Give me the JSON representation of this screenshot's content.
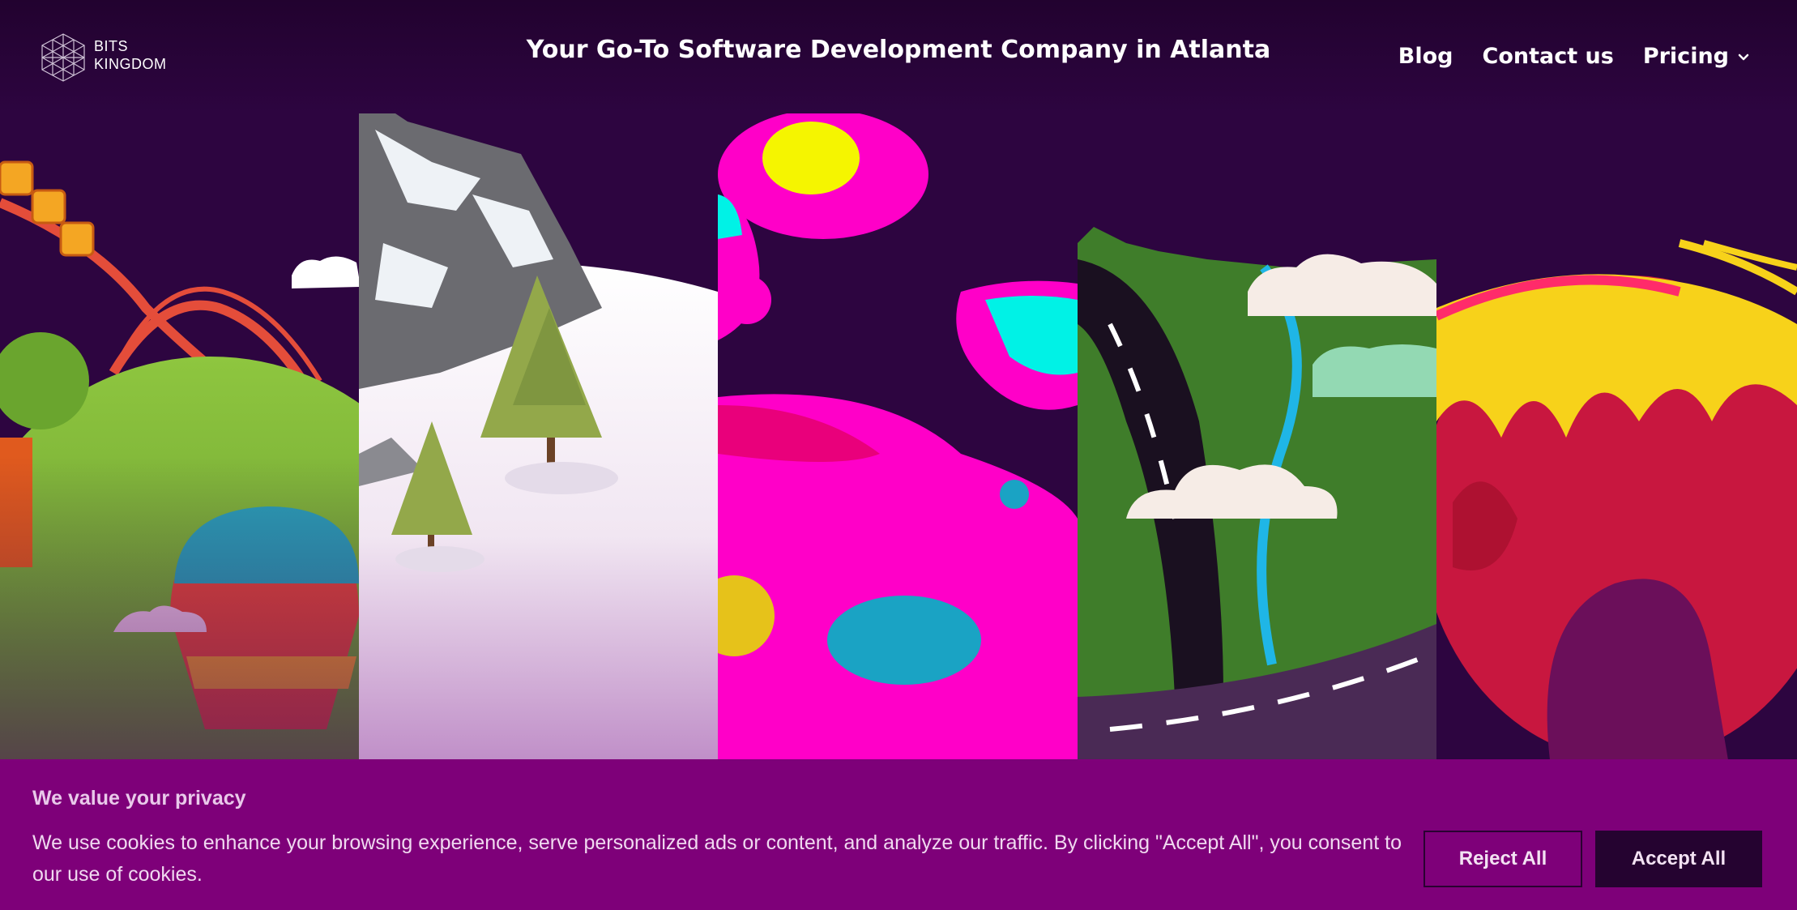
{
  "header": {
    "logo_line1": "BITS",
    "logo_line2": "KINGDOM",
    "headline": "Your Go-To Software Development Company in Atlanta",
    "nav": [
      {
        "label": "Blog"
      },
      {
        "label": "Contact us"
      },
      {
        "label": "Pricing"
      }
    ]
  },
  "hero": {
    "panels": [
      "amusement-park-world",
      "snowy-mountain-world",
      "pink-blob-world",
      "green-road-world",
      "fiery-planet-world"
    ]
  },
  "cookie_banner": {
    "title": "We value your privacy",
    "text": "We use cookies to enhance your browsing experience, serve personalized ads or content, and analyze our traffic. By clicking \"Accept All\", you consent to our use of cookies.",
    "reject_label": "Reject All",
    "accept_label": "Accept All"
  },
  "colors": {
    "background": "#2a0340",
    "banner": "#7e0079",
    "accept_button": "#250330"
  }
}
